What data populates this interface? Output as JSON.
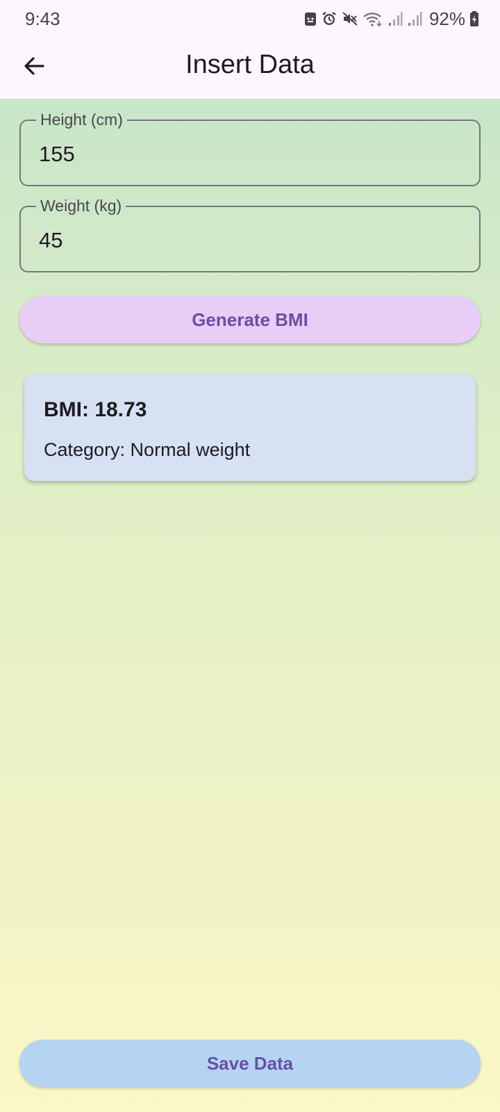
{
  "status_bar": {
    "time": "9:43",
    "battery": "92%",
    "icons": [
      "android-system-icon",
      "alarm-icon",
      "mute-icon",
      "wifi-icon",
      "signal-icon",
      "signal-icon",
      "battery-charging-icon"
    ]
  },
  "app_bar": {
    "back_icon": "arrow-back-icon",
    "title": "Insert Data"
  },
  "form": {
    "height_label": "Height (cm)",
    "height_value": "155",
    "weight_label": "Weight (kg)",
    "weight_value": "45",
    "generate_label": "Generate BMI"
  },
  "result": {
    "bmi": "BMI: 18.73",
    "category": "Category: Normal weight"
  },
  "save_label": "Save Data",
  "colors": {
    "accent": "#6750a4",
    "generate_button": "#e8cdf6",
    "save_button": "#b5d4f4",
    "card": "#d6e1f3",
    "gradient_top": "#c8e6c9",
    "gradient_bottom": "#fbf7c6"
  }
}
